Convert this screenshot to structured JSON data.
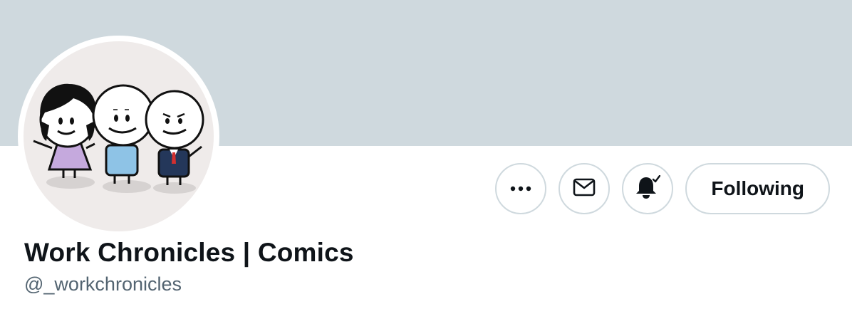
{
  "profile": {
    "display_name": "Work Chronicles | Comics",
    "handle": "@_workchronicles"
  },
  "actions": {
    "more_icon": "more-horizontal-icon",
    "message_icon": "envelope-icon",
    "notifications_icon": "bell-subscribed-icon",
    "follow_label": "Following"
  },
  "colors": {
    "banner": "#cfd9de",
    "text_primary": "#0f1419",
    "text_secondary": "#536471",
    "border": "#cfd9de"
  }
}
